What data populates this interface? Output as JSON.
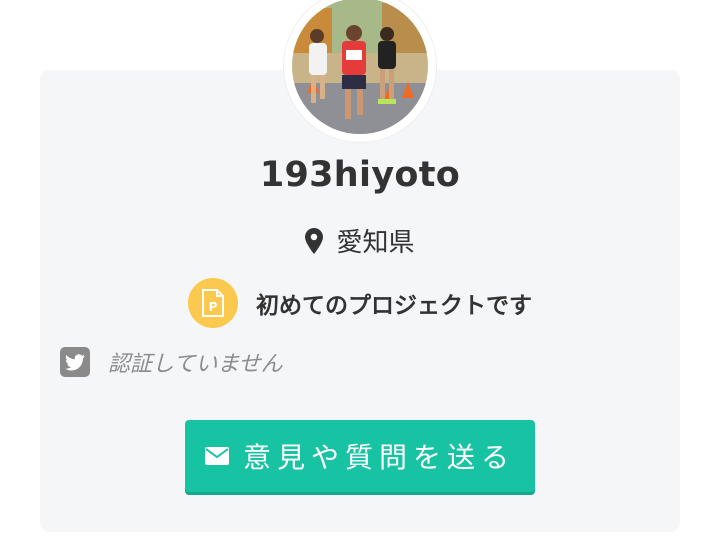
{
  "profile": {
    "username": "193hiyoto",
    "location": "愛知県",
    "project_label": "初めてのプロジェクトです",
    "twitter_status": "認証していません"
  },
  "contact_button": {
    "label": "意見や質問を送る"
  },
  "icons": {
    "location": "map-pin-icon",
    "project": "project-badge-icon",
    "twitter": "twitter-icon",
    "mail": "mail-icon"
  },
  "colors": {
    "card_bg": "#f5f6f8",
    "accent": "#17c3a3",
    "project_badge": "#fbc94d",
    "text": "#333333",
    "muted": "#8c8c8c"
  }
}
